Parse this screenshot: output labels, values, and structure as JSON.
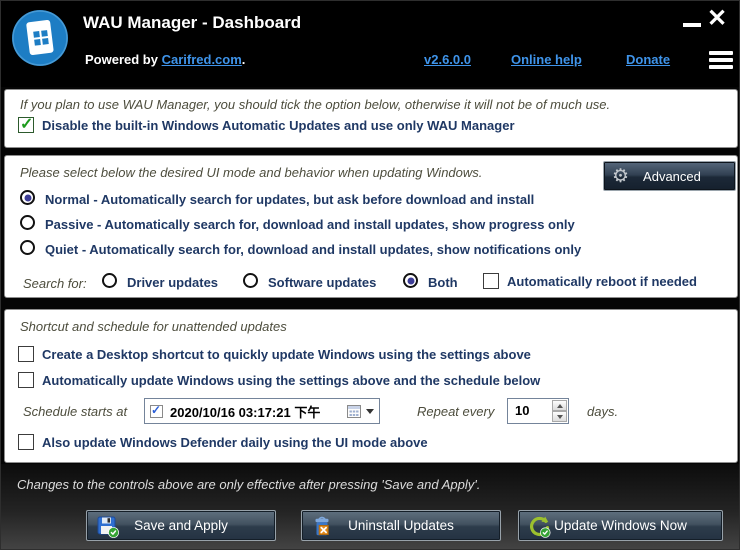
{
  "colors": {
    "link_blue": "#3f94ea",
    "label_navy": "#1f3864",
    "section_header_olive": "#4d4d3d",
    "check_green": "#1d9b1d",
    "radio_dot_blue": "#3c3c96",
    "logo_blue": "#1d7dc4"
  },
  "icons": {
    "close": "✕",
    "gear": "⚙",
    "check": "✓"
  },
  "header": {
    "title": "WAU Manager - Dashboard",
    "powered_by": "Powered by",
    "powered_link": "Carifred.com",
    "powered_suffix": ".",
    "version_link": "v2.6.0.0",
    "online_help_link": "Online help",
    "donate_link": "Donate"
  },
  "setup_section": {
    "intro": "If you plan to use WAU Manager, you should tick the option below, otherwise it will not be of much use.",
    "disable_auto_updates": {
      "label": "Disable the built-in Windows Automatic Updates and use only WAU Manager",
      "checked": true
    }
  },
  "mode_section": {
    "intro": "Please select below the desired UI mode and behavior when updating Windows.",
    "advanced_button": "Advanced",
    "modes": [
      {
        "label": "Normal - Automatically search for updates, but ask before download and install",
        "selected": true
      },
      {
        "label": "Passive - Automatically search for, download and install updates, show progress only",
        "selected": false
      },
      {
        "label": "Quiet - Automatically search for, download and install updates, show notifications only",
        "selected": false
      }
    ],
    "search_for_label": "Search for:",
    "search_options": [
      {
        "label": "Driver updates",
        "selected": false
      },
      {
        "label": "Software updates",
        "selected": false
      },
      {
        "label": "Both",
        "selected": true
      }
    ],
    "reboot_checkbox": {
      "label": "Automatically reboot if needed",
      "checked": false
    }
  },
  "schedule_section": {
    "intro": "Shortcut and schedule for unattended updates",
    "desktop_shortcut_checkbox": {
      "label": "Create a Desktop shortcut to quickly update Windows using the settings above",
      "checked": false
    },
    "auto_update_checkbox": {
      "label": "Automatically update Windows using the settings above and the schedule below",
      "checked": false
    },
    "schedule_starts_label": "Schedule starts at",
    "schedule_value": "2020/10/16  03:17:21 下午",
    "schedule_checked": true,
    "repeat_label": "Repeat every",
    "repeat_value": "10",
    "days_label": "days.",
    "defender_checkbox": {
      "label": "Also update Windows Defender daily using the UI mode above",
      "checked": false
    }
  },
  "footer": {
    "note": "Changes to the controls above are only effective after pressing 'Save and Apply'.",
    "save_button": "Save and Apply",
    "uninstall_button": "Uninstall Updates",
    "update_button": "Update Windows Now"
  }
}
